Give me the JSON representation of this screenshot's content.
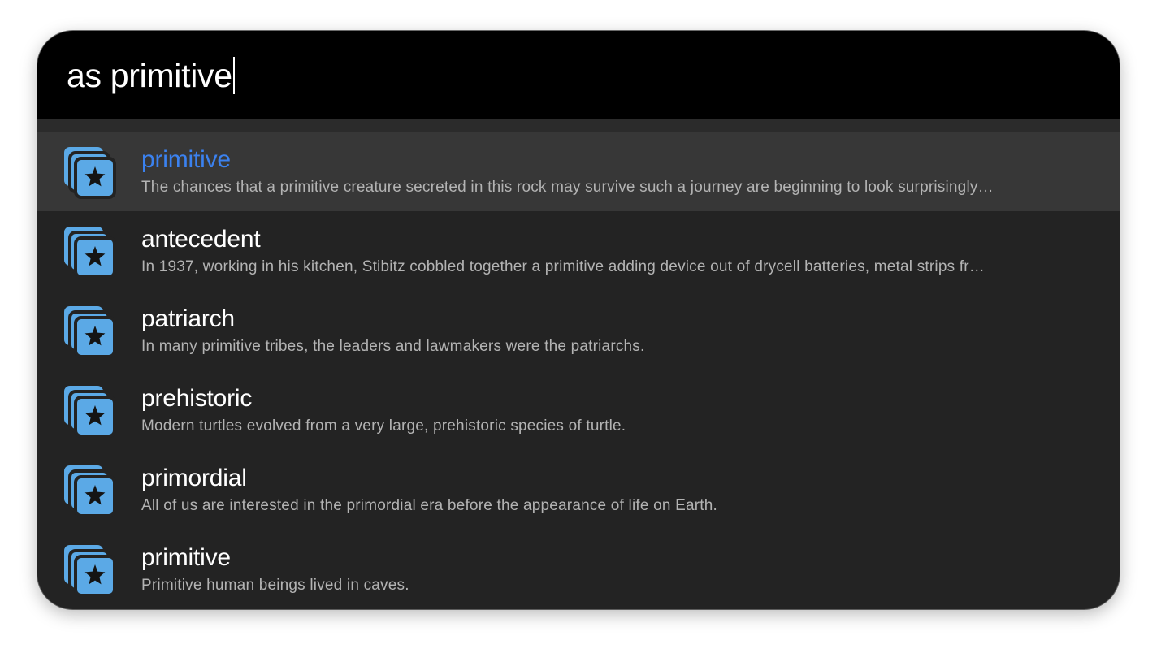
{
  "search": {
    "query": "as primitive"
  },
  "results": [
    {
      "title": "primitive",
      "subtitle": "The chances that a primitive creature secreted in this rock may survive such a journey are beginning to look surprisingly…",
      "icon": "bookmark-star-icon",
      "selected": true
    },
    {
      "title": "antecedent",
      "subtitle": "In 1937, working in his kitchen, Stibitz cobbled together a primitive adding device out of drycell batteries, metal strips fr…",
      "icon": "bookmark-star-icon",
      "selected": false
    },
    {
      "title": "patriarch",
      "subtitle": "In many primitive tribes, the leaders and lawmakers were the patriarchs.",
      "icon": "bookmark-star-icon",
      "selected": false
    },
    {
      "title": "prehistoric",
      "subtitle": "Modern turtles evolved from a very large, prehistoric species of turtle.",
      "icon": "bookmark-star-icon",
      "selected": false
    },
    {
      "title": "primordial",
      "subtitle": "All of us are interested in the primordial era before the appearance of life on Earth.",
      "icon": "bookmark-star-icon",
      "selected": false
    },
    {
      "title": "primitive",
      "subtitle": "Primitive human beings lived in caves.",
      "icon": "bookmark-star-icon",
      "selected": false
    }
  ],
  "colors": {
    "accent": "#3b82f0",
    "icon_fill": "#5ba9e6",
    "background": "#232323",
    "search_background": "#000000",
    "selected_row": "#373737"
  }
}
